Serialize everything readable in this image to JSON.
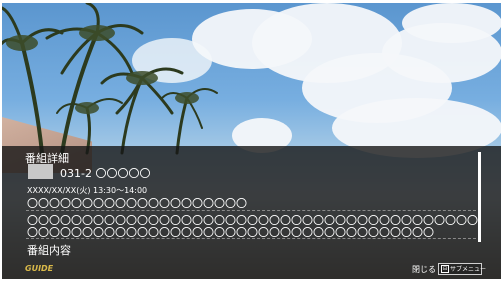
{
  "detail": {
    "title": "番組詳細",
    "channel": "031-2 〇〇〇〇〇",
    "datetime": "XXXX/XX/XX(火) 13:30～14:00",
    "program_title": "〇〇〇〇〇〇〇〇〇〇〇〇〇〇〇〇〇〇〇〇",
    "description_lines": [
      "〇〇〇〇〇〇〇〇〇〇〇〇〇〇〇〇〇〇〇〇〇〇〇〇〇〇〇〇〇〇〇〇〇〇〇〇〇〇〇〇〇",
      "〇〇〇〇〇〇〇〇〇〇〇〇〇〇〇〇〇〇〇〇〇〇〇〇〇〇〇〇〇〇〇〇〇〇〇〇〇"
    ],
    "section_label": "番組内容"
  },
  "footer": {
    "logo": "GUIDE",
    "close_label": "閉じる",
    "submenu_icon": "⊟",
    "submenu_label": "サブメニュー"
  },
  "colors": {
    "overlay": "#161616",
    "logo": "#d9b94a",
    "text": "#ffffff"
  }
}
